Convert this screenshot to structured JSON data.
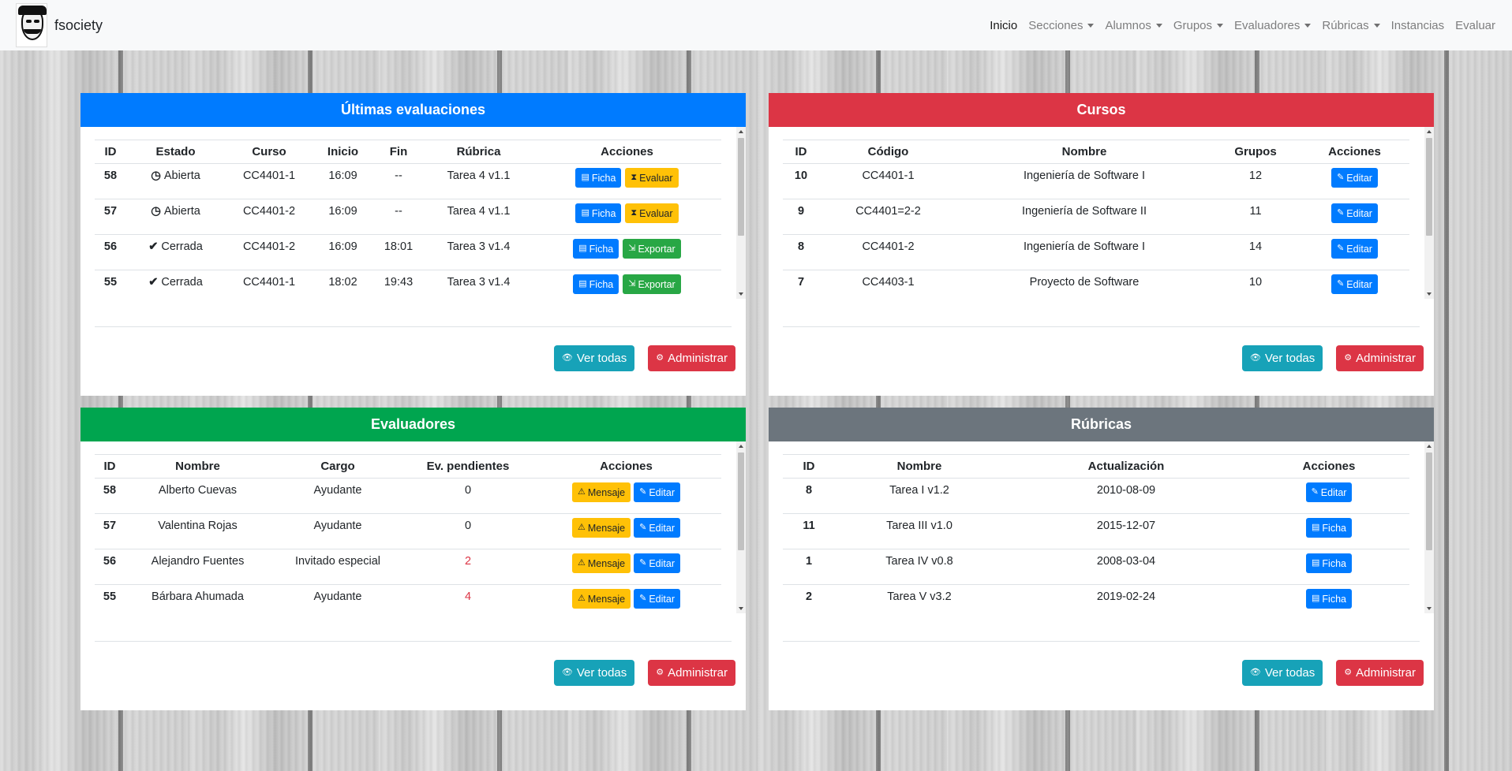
{
  "brand": {
    "name": "fsociety"
  },
  "nav": [
    {
      "label": "Inicio",
      "dropdown": false,
      "active": true
    },
    {
      "label": "Secciones",
      "dropdown": true
    },
    {
      "label": "Alumnos",
      "dropdown": true
    },
    {
      "label": "Grupos",
      "dropdown": true
    },
    {
      "label": "Evaluadores",
      "dropdown": true
    },
    {
      "label": "Rúbricas",
      "dropdown": true
    },
    {
      "label": "Instancias",
      "dropdown": false
    },
    {
      "label": "Evaluar",
      "dropdown": false
    }
  ],
  "evaluaciones": {
    "title": "Últimas evaluaciones",
    "headers": [
      "ID",
      "Estado",
      "Curso",
      "Inicio",
      "Fin",
      "Rúbrica",
      "Acciones"
    ],
    "rows": [
      {
        "id": "58",
        "estado": "Abierta",
        "estado_icon": "clock-icon",
        "curso": "CC4401-1",
        "inicio": "16:09",
        "fin": "--",
        "rubrica": "Tarea 4 v1.1",
        "actions": [
          "Ficha",
          "Evaluar"
        ]
      },
      {
        "id": "57",
        "estado": "Abierta",
        "estado_icon": "clock-icon",
        "curso": "CC4401-2",
        "inicio": "16:09",
        "fin": "--",
        "rubrica": "Tarea 4 v1.1",
        "actions": [
          "Ficha",
          "Evaluar"
        ]
      },
      {
        "id": "56",
        "estado": "Cerrada",
        "estado_icon": "check-icon",
        "curso": "CC4401-2",
        "inicio": "16:09",
        "fin": "18:01",
        "rubrica": "Tarea 3 v1.4",
        "actions": [
          "Ficha",
          "Exportar"
        ]
      },
      {
        "id": "55",
        "estado": "Cerrada",
        "estado_icon": "check-icon",
        "curso": "CC4401-1",
        "inicio": "18:02",
        "fin": "19:43",
        "rubrica": "Tarea 3 v1.4",
        "actions": [
          "Ficha",
          "Exportar"
        ]
      }
    ],
    "ver_todas": "Ver todas",
    "administrar": "Administrar"
  },
  "cursos": {
    "title": "Cursos",
    "headers": [
      "ID",
      "Código",
      "Nombre",
      "Grupos",
      "Acciones"
    ],
    "rows": [
      {
        "id": "10",
        "codigo": "CC4401-1",
        "nombre": "Ingeniería de Software I",
        "grupos": "12",
        "action": "Editar"
      },
      {
        "id": "9",
        "codigo": "CC4401=2-2",
        "nombre": "Ingeniería de Software II",
        "grupos": "11",
        "action": "Editar"
      },
      {
        "id": "8",
        "codigo": "CC4401-2",
        "nombre": "Ingeniería de Software I",
        "grupos": "14",
        "action": "Editar"
      },
      {
        "id": "7",
        "codigo": "CC4403-1",
        "nombre": "Proyecto de Software",
        "grupos": "10",
        "action": "Editar"
      }
    ],
    "ver_todas": "Ver todas",
    "administrar": "Administrar"
  },
  "evaluadores": {
    "title": "Evaluadores",
    "headers": [
      "ID",
      "Nombre",
      "Cargo",
      "Ev. pendientes",
      "Acciones"
    ],
    "rows": [
      {
        "id": "58",
        "nombre": "Alberto Cuevas",
        "cargo": "Ayudante",
        "pendientes": "0",
        "highlight": false,
        "actions": [
          "Mensaje",
          "Editar"
        ]
      },
      {
        "id": "57",
        "nombre": "Valentina Rojas",
        "cargo": "Ayudante",
        "pendientes": "0",
        "highlight": false,
        "actions": [
          "Mensaje",
          "Editar"
        ]
      },
      {
        "id": "56",
        "nombre": "Alejandro Fuentes",
        "cargo": "Invitado especial",
        "pendientes": "2",
        "highlight": true,
        "actions": [
          "Mensaje",
          "Editar"
        ]
      },
      {
        "id": "55",
        "nombre": "Bárbara Ahumada",
        "cargo": "Ayudante",
        "pendientes": "4",
        "highlight": true,
        "actions": [
          "Mensaje",
          "Editar"
        ]
      }
    ],
    "ver_todas": "Ver todas",
    "administrar": "Administrar"
  },
  "rubricas": {
    "title": "Rúbricas",
    "headers": [
      "ID",
      "Nombre",
      "Actualización",
      "Acciones"
    ],
    "rows": [
      {
        "id": "8",
        "nombre": "Tarea I v1.2",
        "actualizacion": "2010-08-09",
        "action": "Editar"
      },
      {
        "id": "11",
        "nombre": "Tarea III v1.0",
        "actualizacion": "2015-12-07",
        "action": "Ficha"
      },
      {
        "id": "1",
        "nombre": "Tarea IV v0.8",
        "actualizacion": "2008-03-04",
        "action": "Ficha"
      },
      {
        "id": "2",
        "nombre": "Tarea V v3.2",
        "actualizacion": "2019-02-24",
        "action": "Ficha"
      }
    ],
    "ver_todas": "Ver todas",
    "administrar": "Administrar"
  },
  "colors": {
    "primary": "#007bff",
    "danger": "#dc3545",
    "success": "#00a54f",
    "secondary": "#6c757d",
    "warning": "#ffc107",
    "info": "#17a2b8"
  }
}
